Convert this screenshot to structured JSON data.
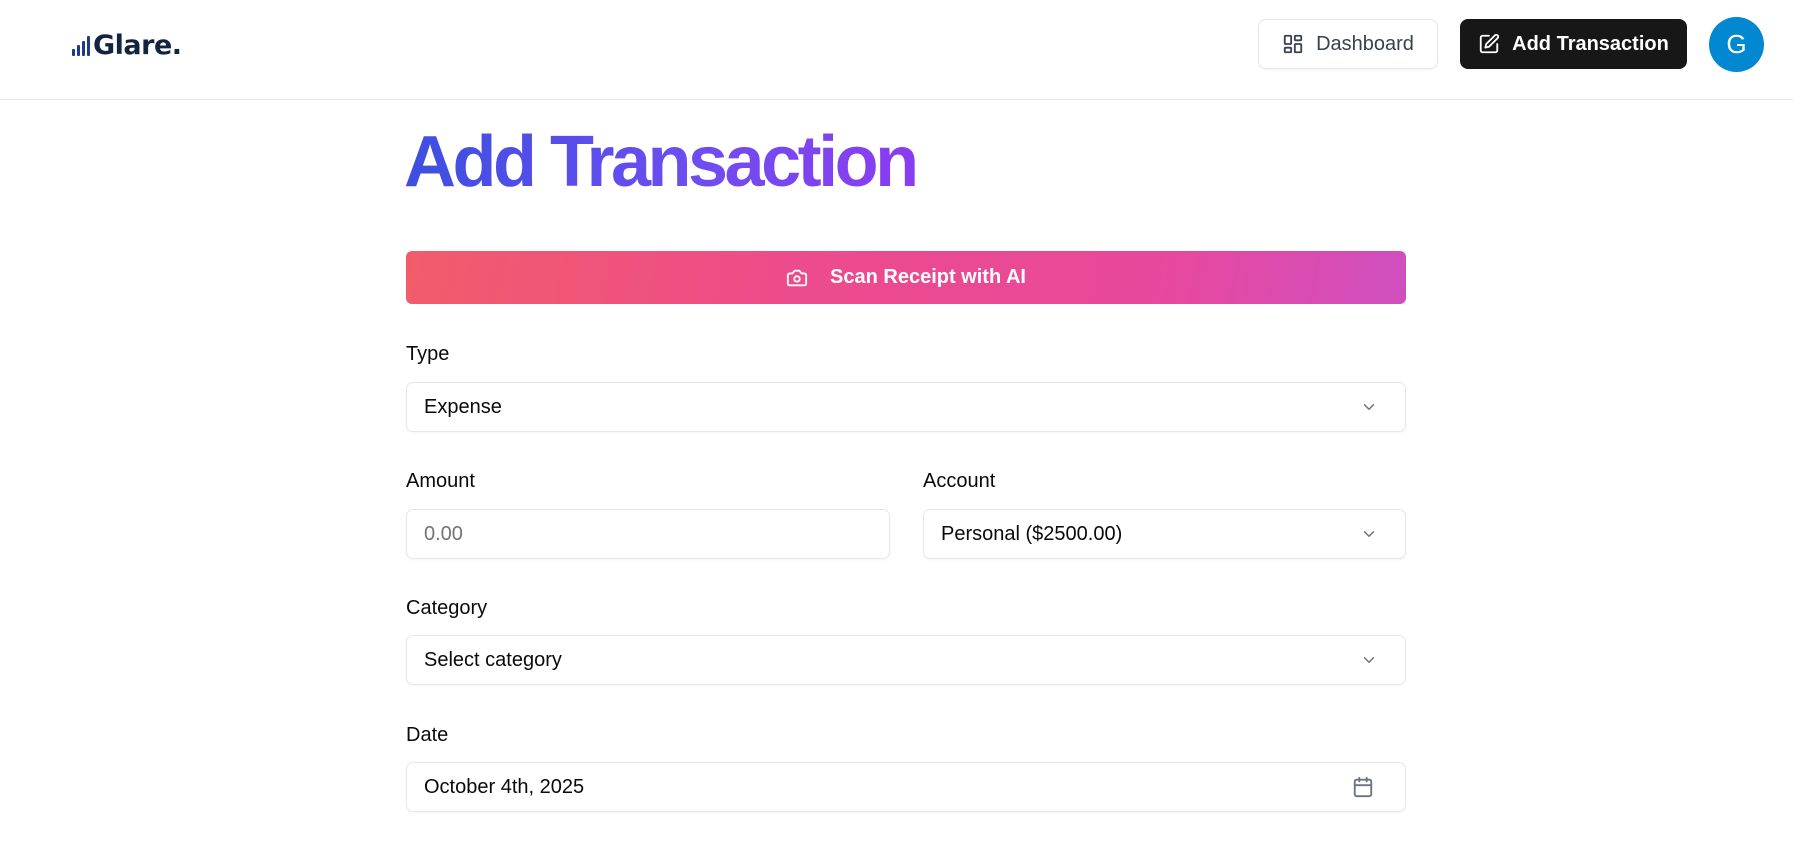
{
  "header": {
    "logo_text": "Glare.",
    "dashboard_label": "Dashboard",
    "add_transaction_label": "Add Transaction",
    "avatar_initial": "G"
  },
  "main": {
    "title": "Add Transaction",
    "scan_button_label": "Scan Receipt with AI",
    "type": {
      "label": "Type",
      "value": "Expense"
    },
    "amount": {
      "label": "Amount",
      "placeholder": "0.00"
    },
    "account": {
      "label": "Account",
      "value": "Personal ($2500.00)"
    },
    "category": {
      "label": "Category",
      "value": "Select category"
    },
    "date": {
      "label": "Date",
      "value": "October 4th, 2025"
    }
  },
  "icons": {
    "logo": "bar-chart-logo-icon",
    "dashboard": "layout-dashboard-icon",
    "add_transaction": "pen-square-icon",
    "scan": "camera-icon",
    "select": "chevron-down-icon",
    "date": "calendar-icon"
  },
  "colors": {
    "primary_button": "#171717",
    "avatar": "#0288d1",
    "title_gradient_start": "#3b4fe0",
    "title_gradient_end": "#8b3cf0",
    "scan_gradient_start": "#f25c6a",
    "scan_gradient_end": "#cf4fc0"
  }
}
